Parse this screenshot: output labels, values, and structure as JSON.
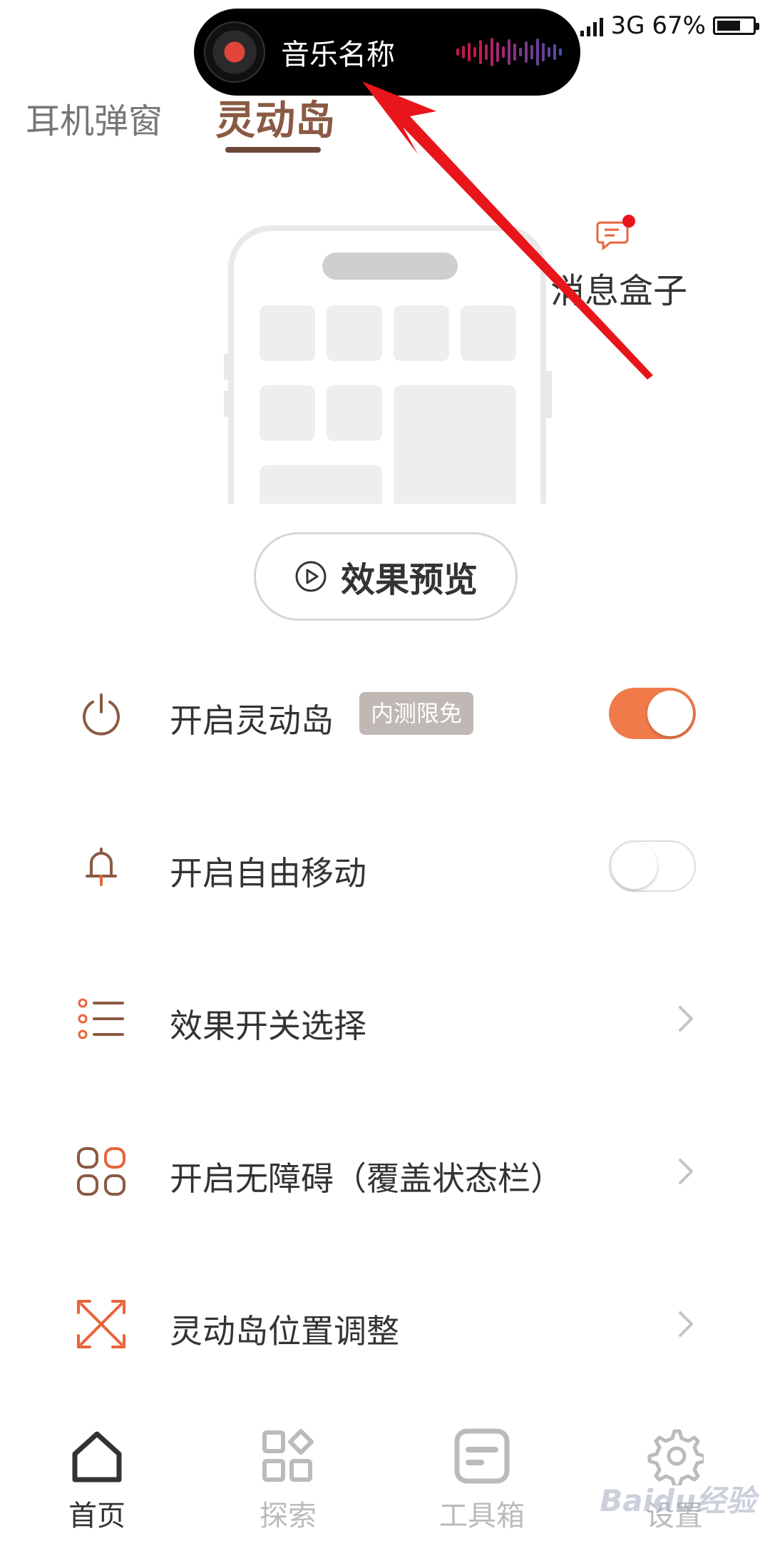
{
  "status_bar": {
    "network": "3G",
    "battery": "67%",
    "battery_level": 0.67
  },
  "island": {
    "song": "音乐名称"
  },
  "tabs": [
    {
      "label": "耳机弹窗",
      "active": false
    },
    {
      "label": "灵动岛",
      "active": true
    }
  ],
  "message_box": {
    "label": "消息盒子",
    "has_unread": true
  },
  "preview_button": {
    "label": "效果预览"
  },
  "settings": {
    "items": [
      {
        "label": "开启灵动岛",
        "icon": "power-icon",
        "badge": "内测限免",
        "control": "toggle",
        "value": true
      },
      {
        "label": "开启自由移动",
        "icon": "bell-icon",
        "control": "toggle",
        "value": false
      },
      {
        "label": "效果开关选择",
        "icon": "list-icon",
        "control": "chevron"
      },
      {
        "label": "开启无障碍（覆盖状态栏）",
        "icon": "grid-icon",
        "control": "chevron"
      },
      {
        "label": "灵动岛位置调整",
        "icon": "resize-icon",
        "control": "chevron"
      }
    ]
  },
  "bottom_nav": [
    {
      "label": "首页",
      "icon": "home-icon",
      "active": true
    },
    {
      "label": "探索",
      "icon": "explore-icon",
      "active": false
    },
    {
      "label": "工具箱",
      "icon": "toolbox-icon",
      "active": false
    },
    {
      "label": "设置",
      "icon": "gear-icon",
      "active": false
    }
  ],
  "colors": {
    "accent": "#f07a4a",
    "active_tab": "#8a5a44",
    "icon_brown": "#8a5a44",
    "arrow": "#e8151b"
  },
  "watermark": "Baidu经验"
}
